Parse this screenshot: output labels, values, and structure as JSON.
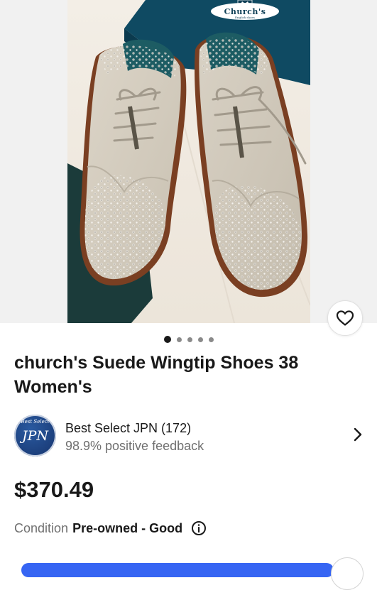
{
  "listing": {
    "title": "church's Suede Wingtip Shoes 38 Women's",
    "image": {
      "brand_text": "Church's",
      "brand_subtext": "English shoes",
      "crest_icon": "crown-crest-icon",
      "carousel": {
        "total": 5,
        "active_index": 0
      }
    },
    "watch_icon": "heart-outline-icon",
    "seller": {
      "avatar_top": "Best Select",
      "avatar_main": "JPN",
      "name": "Best Select JPN (172)",
      "feedback": "98.9% positive feedback",
      "chevron_icon": "chevron-right-icon"
    },
    "price": "$370.49",
    "condition": {
      "label": "Condition",
      "value": "Pre-owned - Good",
      "info_icon": "info-circle-icon"
    }
  },
  "colors": {
    "text_primary": "#191919",
    "text_secondary": "#707070",
    "accent_blue": "#3665f3",
    "box_teal": "#0f4a62",
    "suede": "#cfc7b9",
    "leather_sole": "#8a4b2a"
  }
}
